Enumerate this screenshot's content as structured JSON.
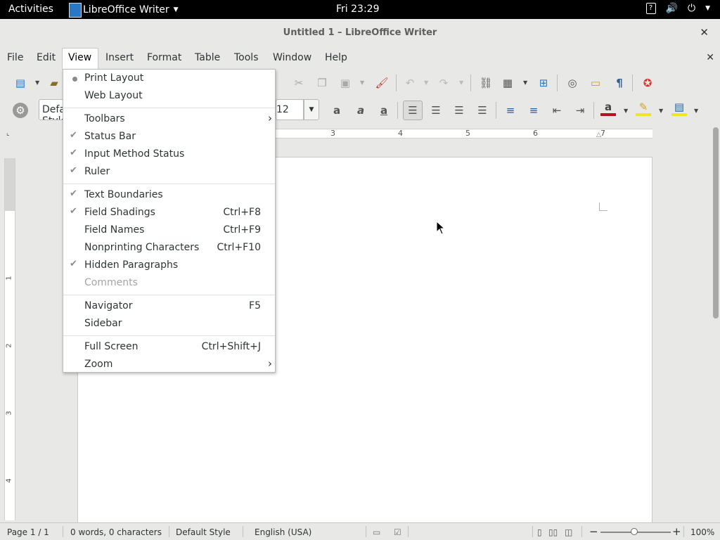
{
  "topbar": {
    "activities": "Activities",
    "app_name": "LibreOffice Writer",
    "clock": "Fri 23:29"
  },
  "window": {
    "title": "Untitled 1 – LibreOffice Writer",
    "close_glyph": "✕"
  },
  "menubar": {
    "items": [
      "File",
      "Edit",
      "View",
      "Insert",
      "Format",
      "Table",
      "Tools",
      "Window",
      "Help"
    ],
    "active": "View",
    "doc_close_glyph": "✕"
  },
  "toolbar": {
    "paragraph_style": "Default Style",
    "font_size": "12"
  },
  "ruler": {
    "h_numbers": [
      "3",
      "4",
      "5",
      "6",
      "7"
    ],
    "v_numbers": [
      "1",
      "2",
      "3",
      "4"
    ]
  },
  "view_menu": {
    "items": [
      {
        "label": "Print Layout",
        "mark": "radio",
        "shortcut": ""
      },
      {
        "label": "Web Layout",
        "mark": "",
        "shortcut": ""
      },
      {
        "label": "Toolbars",
        "mark": "",
        "shortcut": "",
        "submenu": true
      },
      {
        "label": "Status Bar",
        "mark": "check",
        "shortcut": ""
      },
      {
        "label": "Input Method Status",
        "mark": "check",
        "shortcut": ""
      },
      {
        "label": "Ruler",
        "mark": "check",
        "shortcut": ""
      },
      {
        "label": "Text Boundaries",
        "mark": "check",
        "shortcut": ""
      },
      {
        "label": "Field Shadings",
        "mark": "check",
        "shortcut": "Ctrl+F8"
      },
      {
        "label": "Field Names",
        "mark": "",
        "shortcut": "Ctrl+F9"
      },
      {
        "label": "Nonprinting Characters",
        "mark": "",
        "shortcut": "Ctrl+F10"
      },
      {
        "label": "Hidden Paragraphs",
        "mark": "check",
        "shortcut": ""
      },
      {
        "label": "Comments",
        "mark": "",
        "shortcut": "",
        "disabled": true
      },
      {
        "label": "Navigator",
        "mark": "",
        "shortcut": "F5"
      },
      {
        "label": "Sidebar",
        "mark": "",
        "shortcut": ""
      },
      {
        "label": "Full Screen",
        "mark": "",
        "shortcut": "Ctrl+Shift+J"
      },
      {
        "label": "Zoom",
        "mark": "",
        "shortcut": "",
        "submenu": true
      }
    ]
  },
  "statusbar": {
    "page": "Page 1 / 1",
    "words": "0 words, 0 characters",
    "style": "Default Style",
    "language": "English (USA)",
    "zoom": "100%"
  }
}
